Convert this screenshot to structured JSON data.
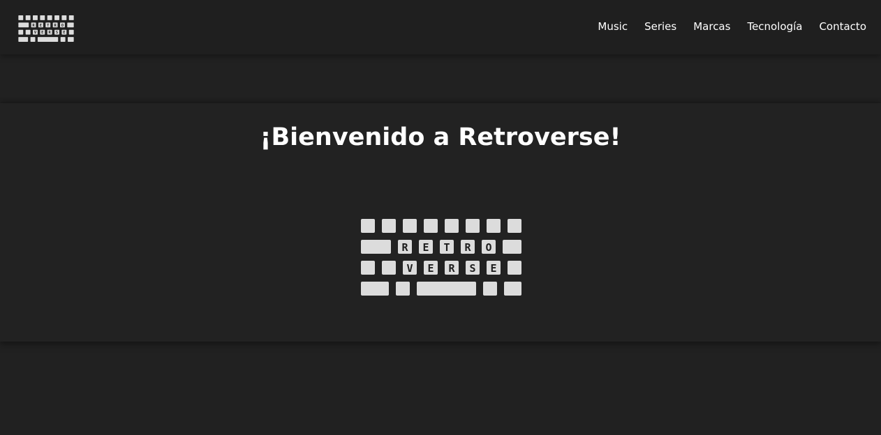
{
  "header": {
    "logo": {
      "row1_letters": [
        "R",
        "E",
        "T",
        "R",
        "O"
      ],
      "row2_letters": [
        "V",
        "E",
        "R",
        "S",
        "E"
      ]
    },
    "nav": [
      {
        "label": "Music"
      },
      {
        "label": "Series"
      },
      {
        "label": "Marcas"
      },
      {
        "label": "Tecnología"
      },
      {
        "label": "Contacto"
      }
    ]
  },
  "hero": {
    "title": "¡Bienvenido a Retroverse!",
    "logo": {
      "row1_letters": [
        "R",
        "E",
        "T",
        "R",
        "O"
      ],
      "row2_letters": [
        "V",
        "E",
        "R",
        "S",
        "E"
      ]
    }
  },
  "colors": {
    "background": "#212121",
    "key": "#dcdcdc",
    "text": "#ffffff"
  }
}
